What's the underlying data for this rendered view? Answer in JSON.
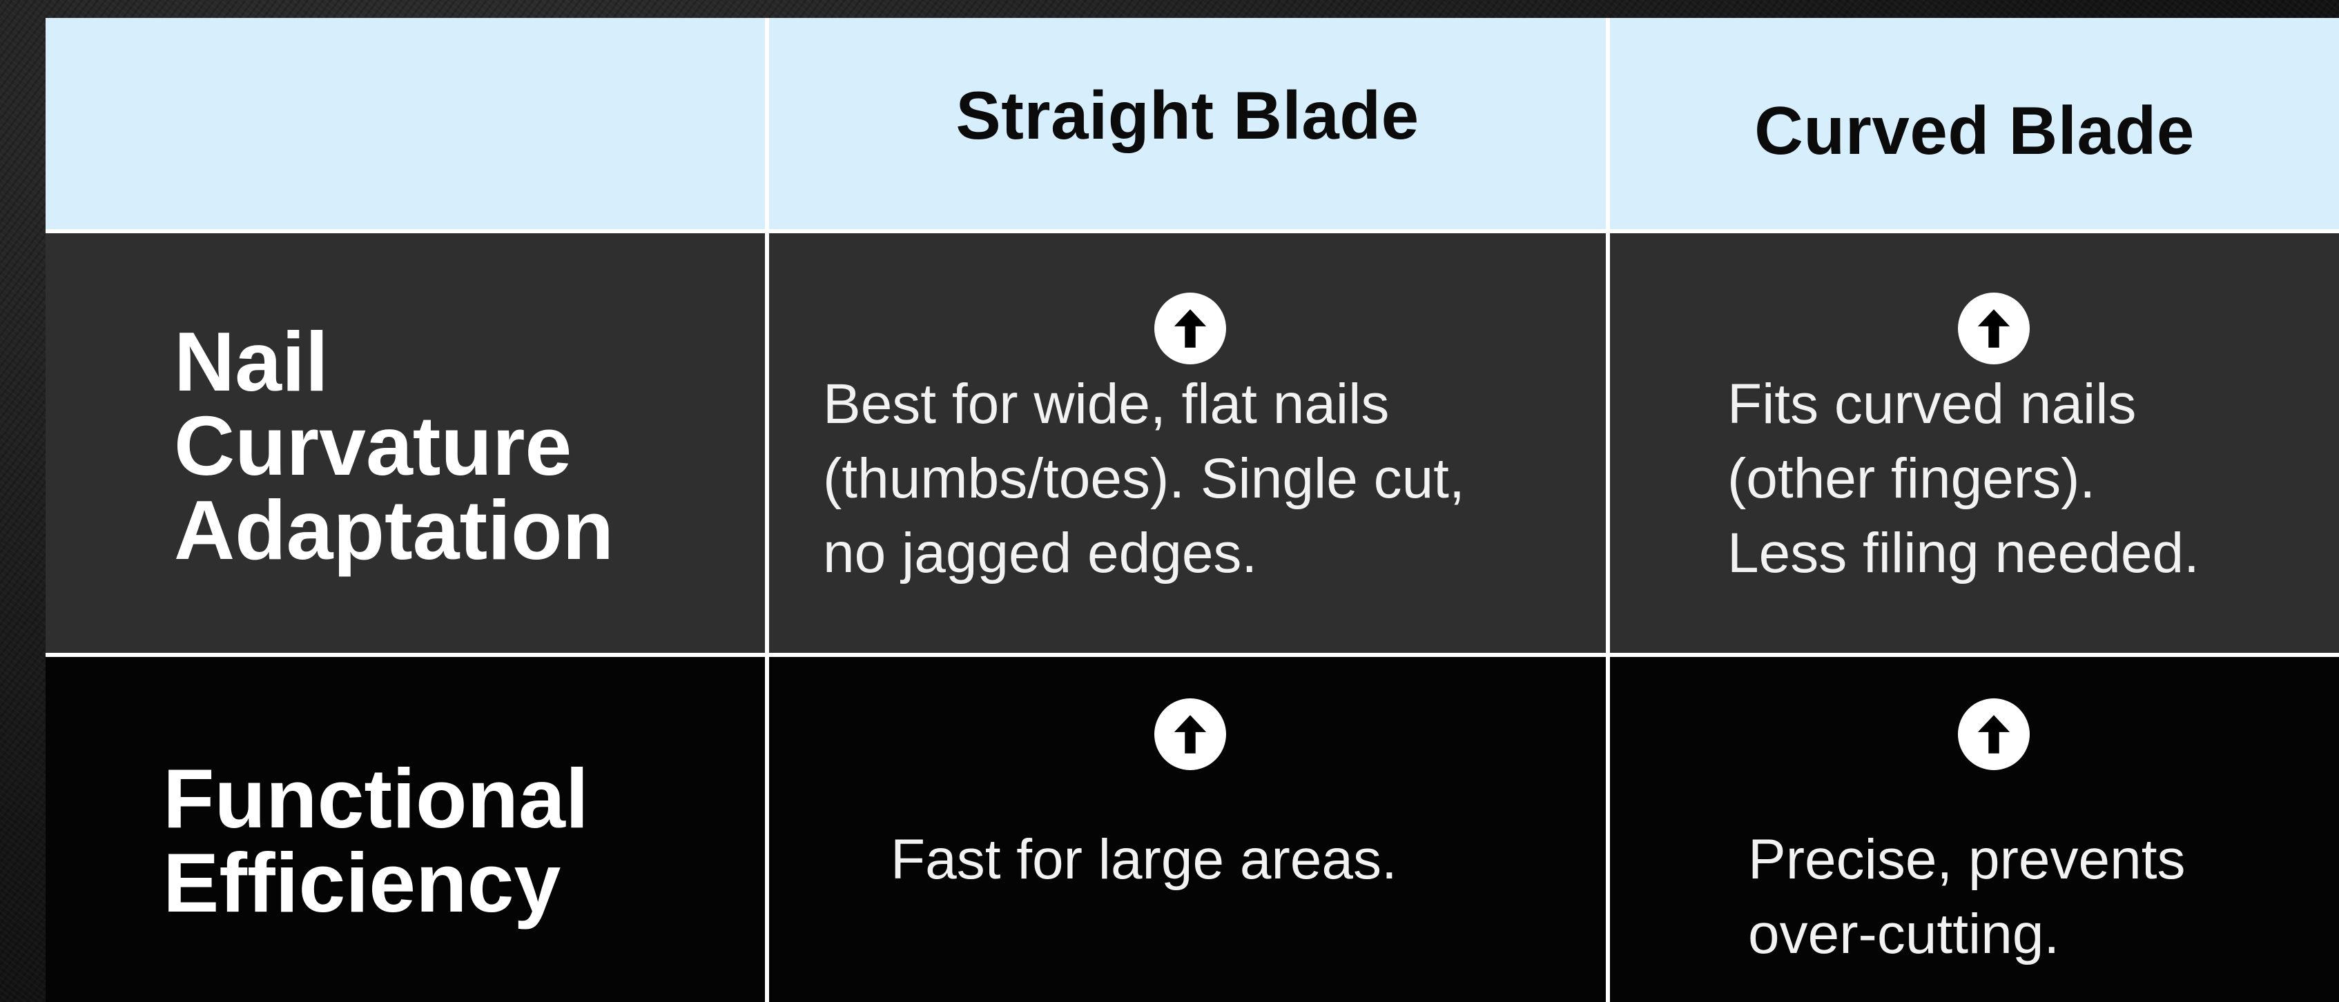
{
  "table": {
    "columns": [
      "",
      "Straight Blade",
      "Curved Blade"
    ],
    "rows": [
      {
        "label_lines": [
          "Nail",
          "Curvature",
          "Adaptation"
        ],
        "straight": {
          "icon": "arrow-up-circle-icon",
          "text": "Best for wide, flat nails\n(thumbs/toes). Single cut,\nno jagged edges."
        },
        "curved": {
          "icon": "arrow-up-circle-icon",
          "text": "Fits curved nails\n(other fingers).\nLess filing needed."
        }
      },
      {
        "label_lines": [
          "Functional",
          "Efficiency"
        ],
        "straight": {
          "icon": "arrow-up-circle-icon",
          "text": "Fast for large areas."
        },
        "curved": {
          "icon": "arrow-up-circle-icon",
          "text": "Precise, prevents\nover-cutting."
        }
      }
    ]
  },
  "colors": {
    "header_bg": "#d7eefd",
    "row1_bg": "#2f2f2f",
    "row2_bg": "#040404",
    "divider": "#ffffff"
  }
}
